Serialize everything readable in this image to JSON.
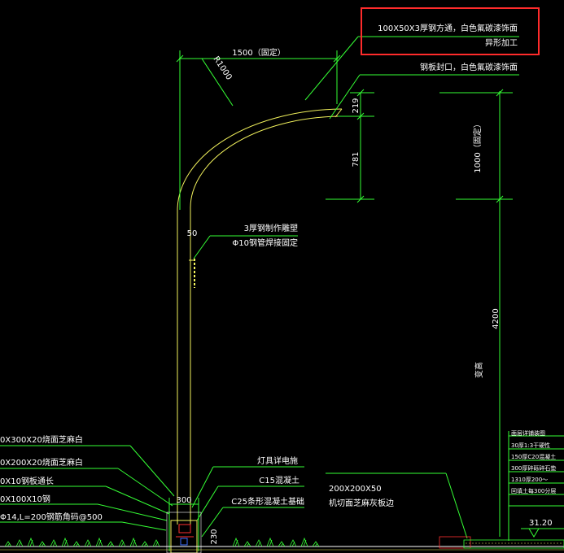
{
  "title_annotation": {
    "line1": "100X50X3厚钢方通，白色氟碳漆饰面",
    "line2": "异形加工"
  },
  "cap_annotation": "钢板封口，白色氟碳漆饰面",
  "dimensions": {
    "width_fixed": "1500（固定）",
    "radius": "R1000",
    "d219": "219",
    "d781": "781",
    "height_fixed": "1000（固定）",
    "total_height": "4200",
    "variable": "变高",
    "d50": "50",
    "base_300": "300",
    "base_230": "230",
    "level": "31.20"
  },
  "joint_annotation": {
    "line1": "3厚钢制作雕塑",
    "line2": "Φ10钢管焊接固定"
  },
  "left_labels": [
    "0X300X20烧面芝麻白",
    "0X200X20烧面芝麻白",
    "0X10钢板通长",
    "0X100X10钢",
    "Φ14,L=200钢筋角码@500"
  ],
  "right_base_labels": {
    "lamp": "灯具详电施",
    "c15": "C15混凝土",
    "c25": "C25条形混凝土基础",
    "curb_size": "200X200X50",
    "curb_desc": "机切面芝麻灰板边"
  },
  "legend_items": [
    "面层详铺装图",
    "30厚1:3干硬性",
    "150厚C20混凝土",
    "300厚碎砾碎石垫",
    "1310厚200～",
    "回填土每300分层"
  ],
  "colors": {
    "background": "#000000",
    "pole": "#f2f25c",
    "dimension": "#35ff35",
    "text": "#ffffff",
    "highlight": "#ff2b2b",
    "accent_red": "#ff3030",
    "accent_blue": "#3a6cff",
    "accent_cyan": "#2ee6e6"
  }
}
